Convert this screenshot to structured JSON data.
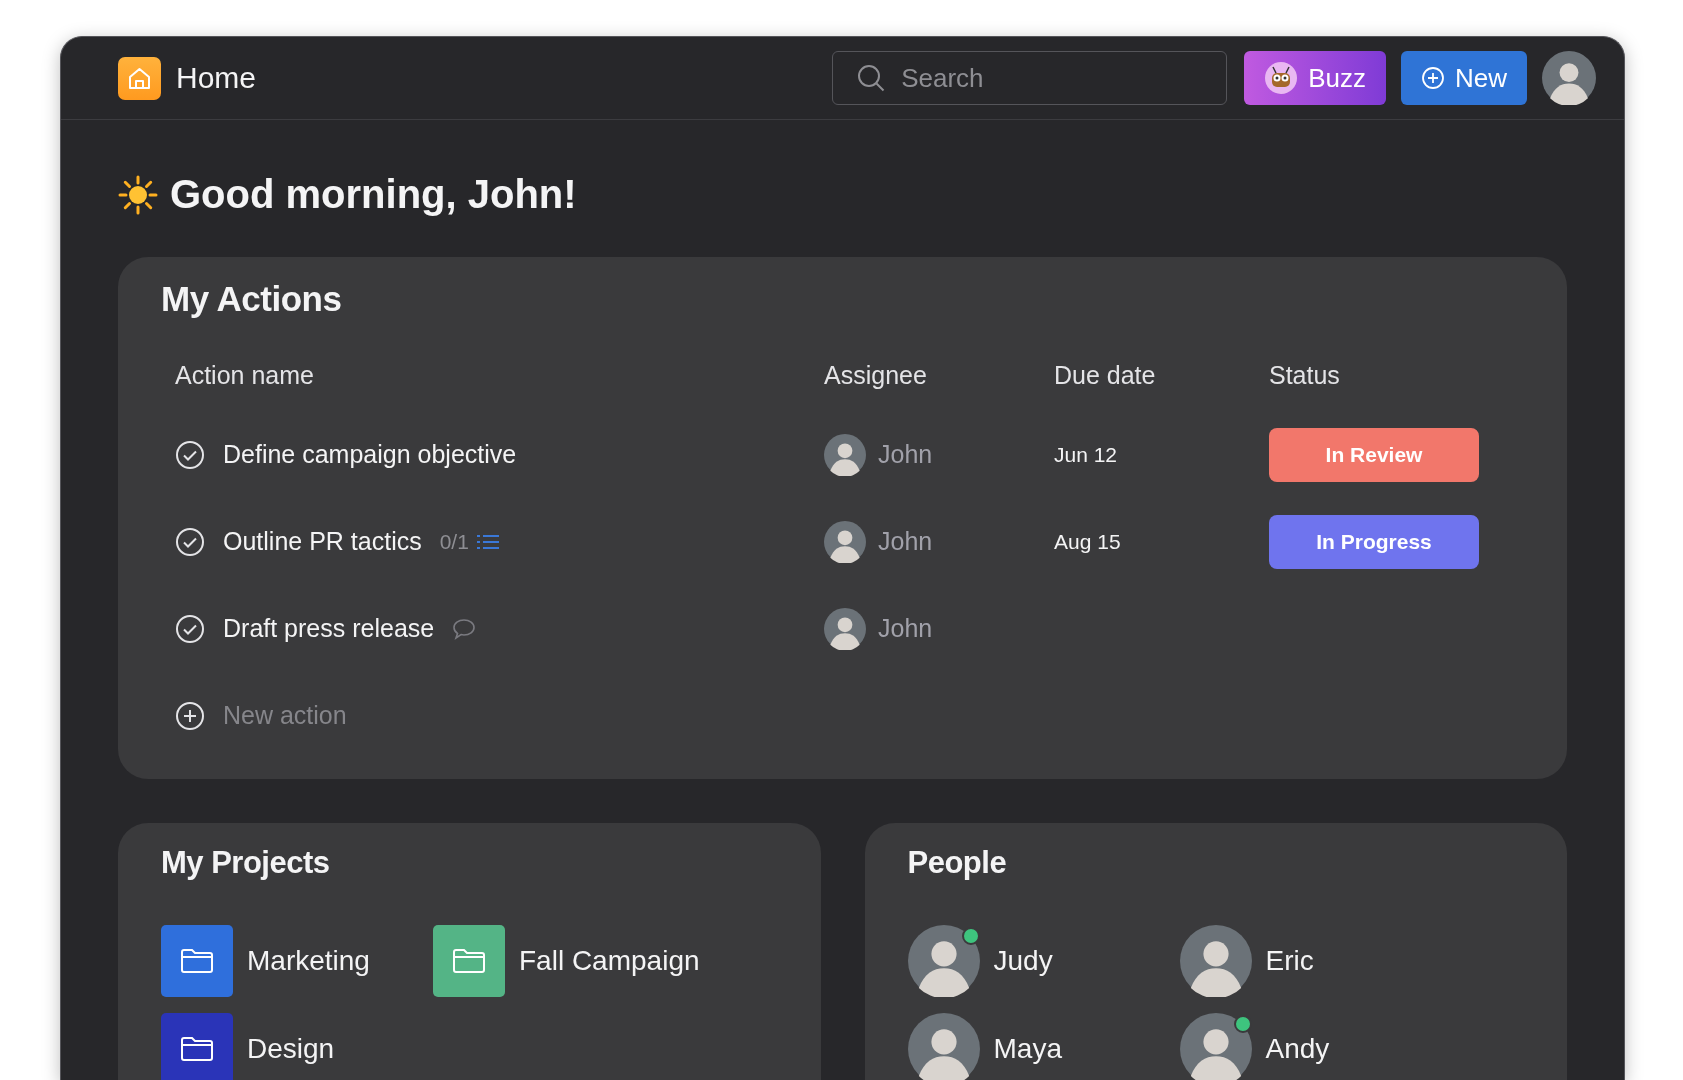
{
  "header": {
    "title": "Home",
    "search": {
      "placeholder": "Search"
    },
    "buttons": [
      {
        "kind": "buzz",
        "label": "Buzz"
      },
      {
        "kind": "new",
        "label": "New"
      }
    ]
  },
  "greeting": "Good morning, John!",
  "actions": {
    "title": "My Actions",
    "columns": [
      "Action name",
      "Assignee",
      "Due date",
      "Status"
    ],
    "rows": [
      {
        "name": "Define campaign objective",
        "assignee": "John",
        "due": "Jun 12",
        "status": {
          "label": "In Review",
          "color": "#f2776b"
        },
        "has_comments": false
      },
      {
        "name": "Outline PR tactics",
        "subtasks": "0/1",
        "assignee": "John",
        "due": "Aug 15",
        "status": {
          "label": "In Progress",
          "color": "#6f74ee"
        },
        "has_comments": false
      },
      {
        "name": "Draft press release",
        "assignee": "John",
        "has_comments": true
      }
    ],
    "new_action": "New action"
  },
  "projects": {
    "title": "My Projects",
    "items": [
      {
        "name": "Marketing",
        "color": "#2f6fdc"
      },
      {
        "name": "Fall Campaign",
        "color": "#54b486"
      },
      {
        "name": "Design",
        "color": "#2a34b8"
      }
    ]
  },
  "people": {
    "title": "People",
    "items": [
      {
        "name": "Judy",
        "online": true
      },
      {
        "name": "Eric",
        "online": false
      },
      {
        "name": "Maya",
        "online": false
      },
      {
        "name": "Andy",
        "online": true
      }
    ]
  }
}
